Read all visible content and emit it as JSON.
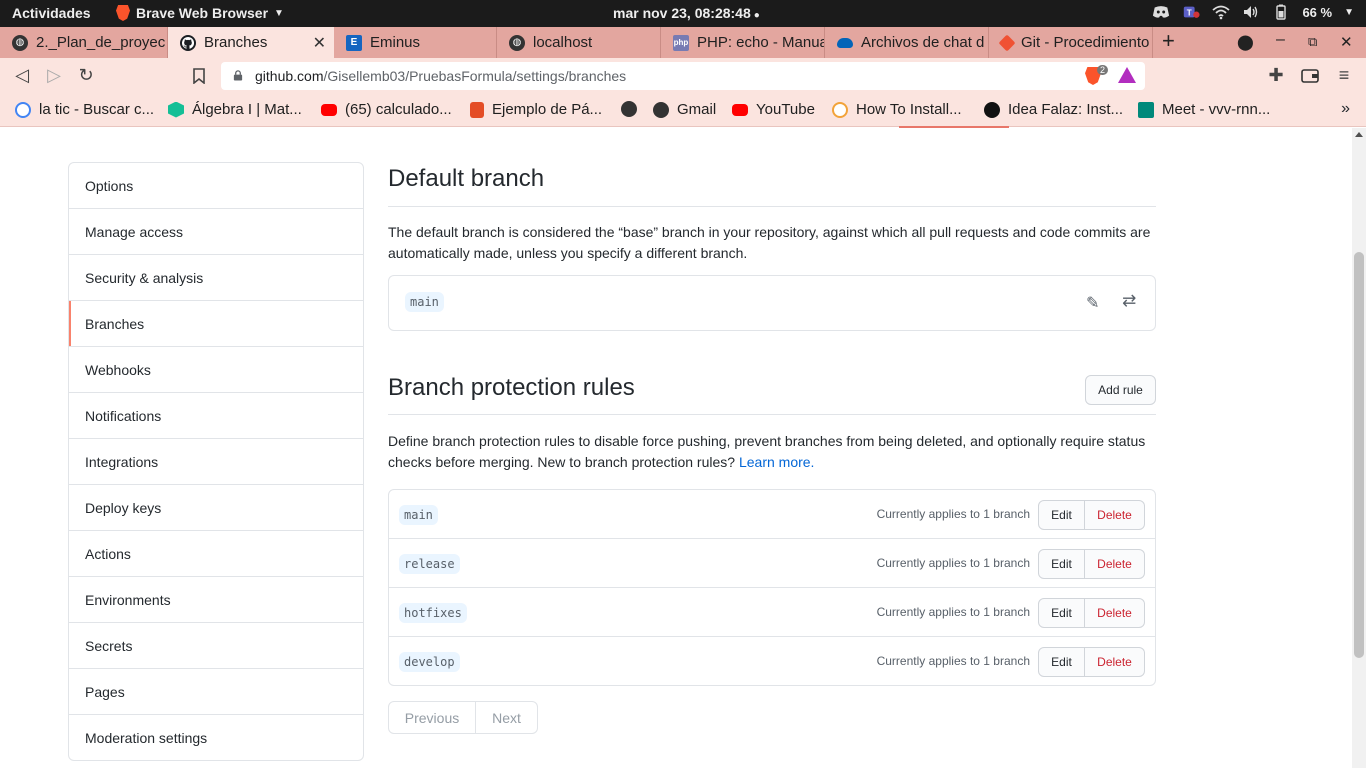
{
  "system": {
    "activities": "Actividades",
    "app_name": "Brave Web Browser",
    "clock": "mar nov 23, 08:28:48",
    "battery": "66 %"
  },
  "tabs": [
    {
      "label": "2._Plan_de_proyec",
      "favicon": "globe-icon"
    },
    {
      "label": "Branches",
      "favicon": "github-icon",
      "active": true
    },
    {
      "label": "Eminus",
      "favicon": "eminus-icon"
    },
    {
      "label": "localhost",
      "favicon": "globe-icon"
    },
    {
      "label": "PHP: echo - Manua",
      "favicon": "php-icon"
    },
    {
      "label": "Archivos de chat d",
      "favicon": "onedrive-icon"
    },
    {
      "label": "Git - Procedimiento",
      "favicon": "git-icon"
    }
  ],
  "address_bar": {
    "host": "github.com",
    "path": "/Gisellemb03/PruebasFormula/settings/branches",
    "shield_count": "2"
  },
  "bookmarks": [
    {
      "label": "la tic - Buscar c...",
      "icon": "google-icon",
      "color": "#4285f4"
    },
    {
      "label": "Álgebra I | Mat...",
      "icon": "khan-icon",
      "color": "#14bf96"
    },
    {
      "label": "(65) calculado...",
      "icon": "youtube-icon",
      "color": "#ff0000"
    },
    {
      "label": "Ejemplo de Pá...",
      "icon": "doc-icon",
      "color": "#e44d26"
    },
    {
      "label": "",
      "icon": "globe-icon",
      "color": "#333333"
    },
    {
      "label": "Gmail",
      "icon": "globe-icon",
      "color": "#333333"
    },
    {
      "label": "YouTube",
      "icon": "youtube-icon",
      "color": "#ff0000"
    },
    {
      "label": "How To Install...",
      "icon": "howto-icon",
      "color": "#f2a33a"
    },
    {
      "label": "Idea Falaz: Inst...",
      "icon": "dot-icon",
      "color": "#111111"
    },
    {
      "label": "Meet - vvv-rnn...",
      "icon": "meet-icon",
      "color": "#00897b"
    }
  ],
  "sidebar": {
    "items": [
      {
        "label": "Options"
      },
      {
        "label": "Manage access"
      },
      {
        "label": "Security & analysis"
      },
      {
        "label": "Branches",
        "selected": true
      },
      {
        "label": "Webhooks"
      },
      {
        "label": "Notifications"
      },
      {
        "label": "Integrations"
      },
      {
        "label": "Deploy keys"
      },
      {
        "label": "Actions"
      },
      {
        "label": "Environments"
      },
      {
        "label": "Secrets"
      },
      {
        "label": "Pages"
      },
      {
        "label": "Moderation settings"
      }
    ]
  },
  "default_branch": {
    "title": "Default branch",
    "description": "The default branch is considered the “base” branch in your repository, against which all pull requests and code commits are automatically made, unless you specify a different branch.",
    "branch": "main"
  },
  "protection": {
    "title": "Branch protection rules",
    "add_rule": "Add rule",
    "description": "Define branch protection rules to disable force pushing, prevent branches from being deleted, and optionally require status checks before merging. New to branch protection rules?",
    "learn_more": "Learn more.",
    "rules": [
      {
        "branch": "main",
        "applies": "Currently applies to 1 branch",
        "edit": "Edit",
        "delete": "Delete"
      },
      {
        "branch": "release",
        "applies": "Currently applies to 1 branch",
        "edit": "Edit",
        "delete": "Delete"
      },
      {
        "branch": "hotfixes",
        "applies": "Currently applies to 1 branch",
        "edit": "Edit",
        "delete": "Delete"
      },
      {
        "branch": "develop",
        "applies": "Currently applies to 1 branch",
        "edit": "Edit",
        "delete": "Delete"
      }
    ]
  },
  "pagination": {
    "previous": "Previous",
    "next": "Next"
  }
}
